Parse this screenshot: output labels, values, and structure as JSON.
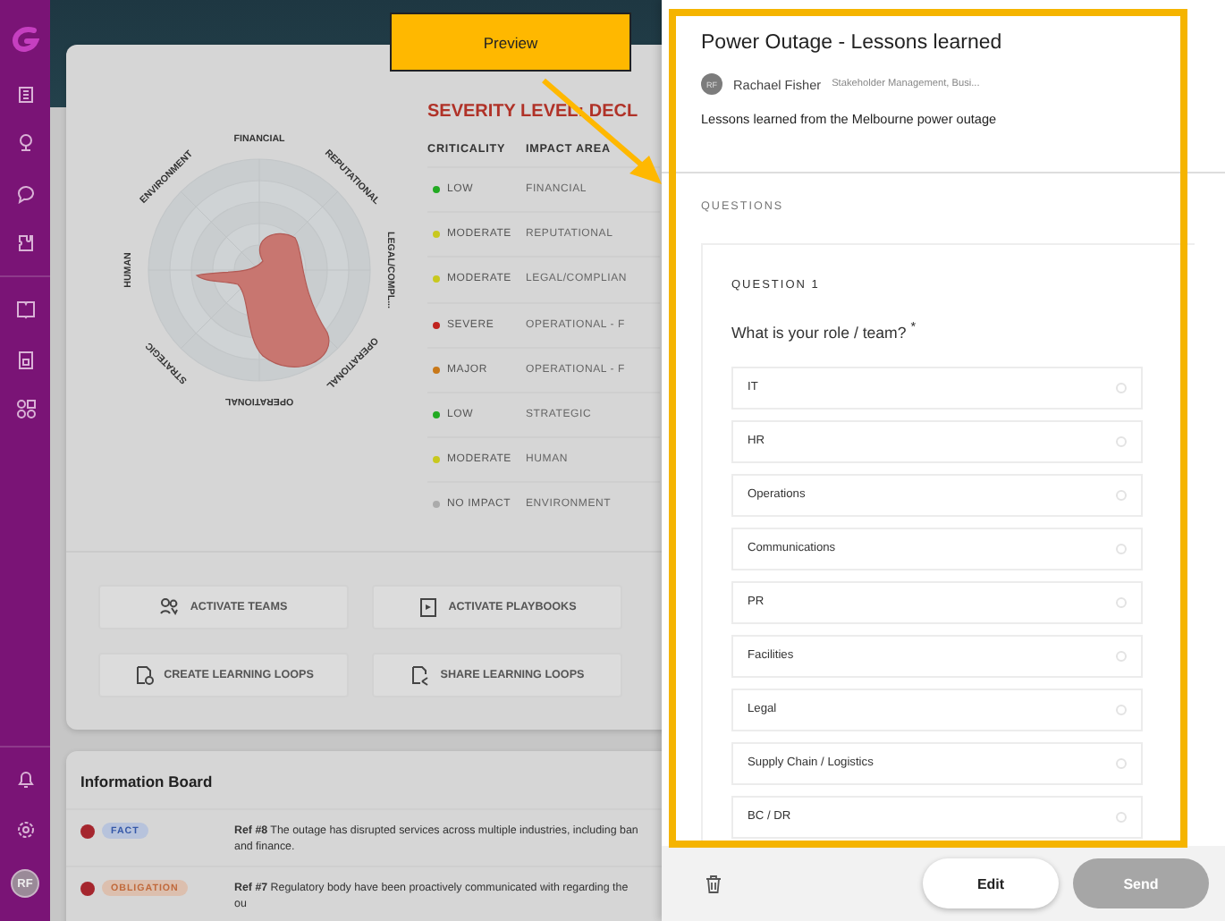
{
  "sidebar": {
    "avatar": "RF"
  },
  "severity": {
    "title": "SEVERITY LEVEL: DECL",
    "columns": [
      "CRITICALITY",
      "IMPACT AREA"
    ],
    "radar_labels": [
      "FINANCIAL",
      "REPUTATIONAL",
      "LEGAL/COMPL...",
      "OPERATIONAL",
      "OPERATIONAL",
      "STRATEGIC",
      "HUMAN",
      "ENVIRONMENT"
    ],
    "rows": [
      {
        "criticality": "LOW",
        "color": "#22aa22",
        "area": "FINANCIAL"
      },
      {
        "criticality": "MODERATE",
        "color": "#c8c81e",
        "area": "REPUTATIONAL"
      },
      {
        "criticality": "MODERATE",
        "color": "#c8c81e",
        "area": "LEGAL/COMPLIAN"
      },
      {
        "criticality": "SEVERE",
        "color": "#c0231e",
        "area": "OPERATIONAL - F"
      },
      {
        "criticality": "MAJOR",
        "color": "#c87819",
        "area": "OPERATIONAL - F"
      },
      {
        "criticality": "LOW",
        "color": "#22aa22",
        "area": "STRATEGIC"
      },
      {
        "criticality": "MODERATE",
        "color": "#c8c81e",
        "area": "HUMAN"
      },
      {
        "criticality": "NO IMPACT",
        "color": "#ababab",
        "area": "ENVIRONMENT"
      }
    ]
  },
  "actions": [
    {
      "label": "ACTIVATE TEAMS",
      "kind": "teams"
    },
    {
      "label": "ACTIVATE PLAYBOOKS",
      "kind": "playbooks"
    },
    {
      "label": "CREATE LEARNING LOOPS",
      "kind": "create"
    },
    {
      "label": "SHARE LEARNING LOOPS",
      "kind": "share"
    }
  ],
  "info_board": {
    "title": "Information Board",
    "items": [
      {
        "color": "#a5262e",
        "tag": "FACT",
        "kind": "fact",
        "text": "**Ref #8** The outage has disrupted services across multiple industries, including ban and finance."
      },
      {
        "color": "#a5262e",
        "tag": "OBLIGATION",
        "kind": "obligation",
        "text": "**Ref #7** Regulatory body have been proactively communicated with regarding the ou"
      }
    ]
  },
  "callout": {
    "label": "Preview"
  },
  "panel": {
    "title": "Power Outage - Lessons learned",
    "author": {
      "initials": "RF",
      "name": "Rachael Fisher",
      "role": "Stakeholder Management, Busi..."
    },
    "description": "Lessons learned from the Melbourne power outage",
    "section": "QUESTIONS",
    "question": {
      "label": "QUESTION 1",
      "text": "What is your role / team? $^{*}$",
      "options": [
        {
          "label": "IT",
          "selected": false
        },
        {
          "label": "HR",
          "selected": false
        },
        {
          "label": "Operations",
          "selected": false
        },
        {
          "label": "Communications",
          "selected": false
        },
        {
          "label": "PR",
          "selected": false
        },
        {
          "label": "Facilities",
          "selected": false
        },
        {
          "label": "Legal",
          "selected": false
        },
        {
          "label": "Supply Chain / Logistics",
          "selected": false
        },
        {
          "label": "BC / DR",
          "selected": false
        }
      ]
    },
    "buttons": [
      {
        "label": "Edit",
        "disabled": false
      },
      {
        "label": "Send",
        "disabled": true
      }
    ]
  }
}
